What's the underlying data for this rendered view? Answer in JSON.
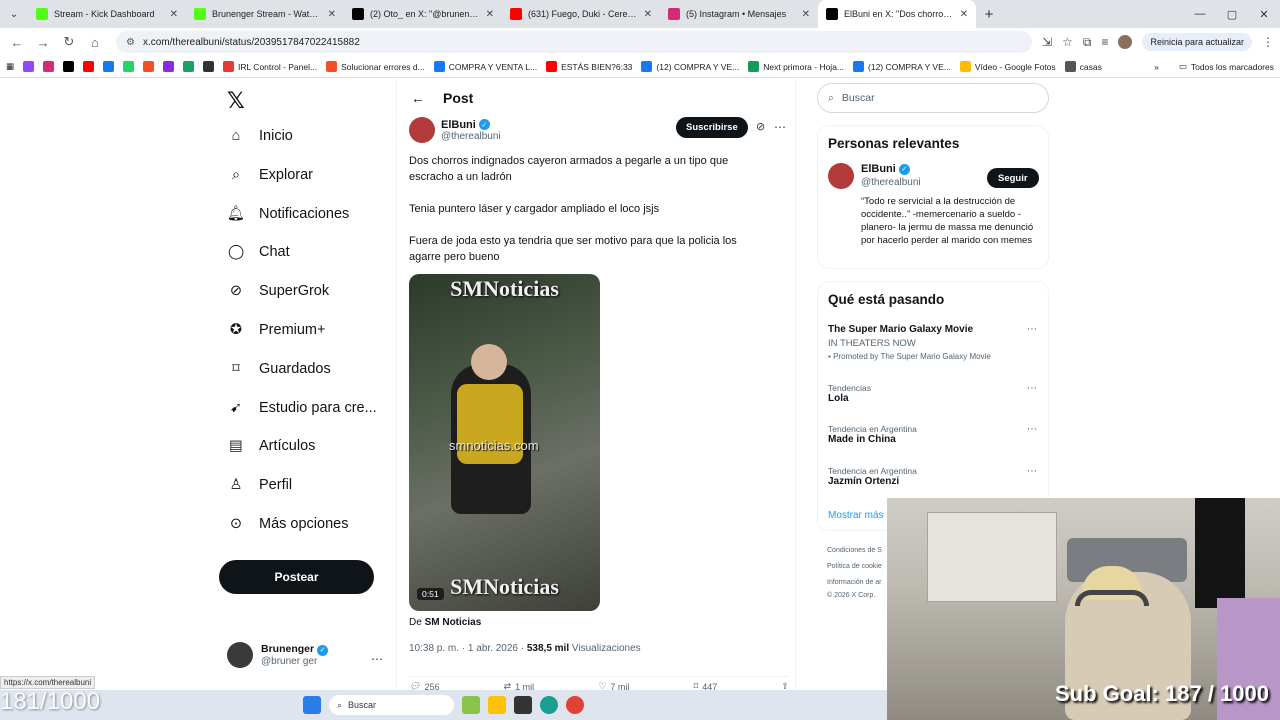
{
  "browser": {
    "tabs": [
      {
        "title": "Stream - Kick Dashboard",
        "icon": "kick-icon",
        "color": "#53fc18",
        "active": false
      },
      {
        "title": "Brunenger Stream - Watch Live",
        "icon": "kick-icon",
        "color": "#53fc18",
        "active": false
      },
      {
        "title": "(2) Oto_ en X: \"@brunenger\"",
        "icon": "x-icon",
        "color": "#000000",
        "active": false
      },
      {
        "title": "(631) Fuego, Duki - Cereza - You",
        "icon": "youtube-icon",
        "color": "#ff0000",
        "active": false
      },
      {
        "title": "(5) Instagram • Mensajes",
        "icon": "instagram-icon",
        "color": "#d62976",
        "active": false
      },
      {
        "title": "ElBuni en X: \"Dos chorros indign",
        "icon": "x-icon",
        "color": "#000000",
        "active": true
      }
    ],
    "url": "x.com/therealbuni/status/2039517847022415882",
    "update_label": "Reinicia para actualizar",
    "bookmarks": [
      {
        "label": "",
        "color": "#9146ff"
      },
      {
        "label": "",
        "color": "#d62976"
      },
      {
        "label": "",
        "color": "#000000"
      },
      {
        "label": "",
        "color": "#ff0000"
      },
      {
        "label": "",
        "color": "#1877f2"
      },
      {
        "label": "",
        "color": "#25d366"
      },
      {
        "label": "",
        "color": "#f25022"
      },
      {
        "label": "",
        "color": "#8a2be2"
      },
      {
        "label": "",
        "color": "#1aa260"
      },
      {
        "label": "",
        "color": "#333333"
      },
      {
        "label": "IRL Control - Panel...",
        "color": "#e53935"
      },
      {
        "label": "Solucionar errores d...",
        "color": "#f25022"
      },
      {
        "label": "COMPRA Y VENTA L...",
        "color": "#1877f2"
      },
      {
        "label": "ESTÁS BIEN?6:33",
        "color": "#ff0000"
      },
      {
        "label": "(12) COMPRA Y VE...",
        "color": "#1877f2"
      },
      {
        "label": "Next primora - Hoja...",
        "color": "#0f9d58"
      },
      {
        "label": "(12) COMPRA Y VE...",
        "color": "#1877f2"
      },
      {
        "label": "Vídeo - Google Fotos",
        "color": "#fbbc04"
      },
      {
        "label": "casas",
        "color": "#555555"
      }
    ],
    "bookmarks_all": "Todos los marcadores"
  },
  "nav": {
    "items": [
      {
        "label": "Inicio",
        "icon": "home-icon"
      },
      {
        "label": "Explorar",
        "icon": "search-icon"
      },
      {
        "label": "Notificaciones",
        "icon": "bell-icon"
      },
      {
        "label": "Chat",
        "icon": "chat-icon"
      },
      {
        "label": "SuperGrok",
        "icon": "grok-icon"
      },
      {
        "label": "Premium+",
        "icon": "verified-icon"
      },
      {
        "label": "Guardados",
        "icon": "bookmark-icon"
      },
      {
        "label": "Estudio para cre...",
        "icon": "rocket-icon"
      },
      {
        "label": "Artículos",
        "icon": "article-icon"
      },
      {
        "label": "Perfil",
        "icon": "person-icon"
      },
      {
        "label": "Más opciones",
        "icon": "more-circle-icon"
      }
    ],
    "post_label": "Postear",
    "account": {
      "name": "Brunenger",
      "handle": "@bruner ger"
    }
  },
  "post": {
    "header": "Post",
    "author": {
      "name": "ElBuni",
      "handle": "@therealbuni"
    },
    "subscribe_label": "Suscribirse",
    "paragraphs": [
      "Dos chorros indignados cayeron armados a pegarle a un tipo que escracho a un ladrón",
      "Tenia puntero láser y cargador ampliado el loco jsjs",
      "Fuera de joda esto ya tendria que ser motivo para que la policia los agarre pero bueno"
    ],
    "media": {
      "watermark": "SMNoticias",
      "site": "smnoticias.com",
      "duration": "0:51"
    },
    "from_prefix": "De",
    "from_source": "SM Noticias",
    "time": "10:38 p. m. · 1 abr. 2026 ·",
    "views_count": "538,5 mil",
    "views_label": "Visualizaciones",
    "stats": {
      "replies": "256",
      "reposts": "1 mil",
      "likes": "7 mil",
      "bookmarks": "447"
    }
  },
  "sidebar": {
    "search_placeholder": "Buscar",
    "relevant_title": "Personas relevantes",
    "relevant": {
      "name": "ElBuni",
      "handle": "@therealbuni",
      "follow_label": "Seguir",
      "bio": "“Todo re servicial a la destrucción de occidente..” -memercenario a sueldo - planero- la jermu de massa me denunció por hacerlo perder al marido con memes"
    },
    "trending_title": "Qué está pasando",
    "trends": [
      {
        "category": "",
        "title": "The Super Mario Galaxy Movie",
        "sub": "IN THEATERS NOW",
        "promo": "Promoted by The Super Mario Galaxy Movie"
      },
      {
        "category": "Tendencias",
        "title": "Lola"
      },
      {
        "category": "Tendencia en Argentina",
        "title": "Made in China"
      },
      {
        "category": "Tendencia en Argentina",
        "title": "Jazmín Ortenzi"
      }
    ],
    "show_more": "Mostrar más",
    "footer": [
      "Condiciones de S",
      "Política de cookie",
      "Información de ar",
      "© 2026 X Corp."
    ]
  },
  "overlay": {
    "sub_goal": "Sub Goal:  187 / 1000",
    "left_counter": "181/1000",
    "status_url": "https://x.com/therealbuni"
  },
  "taskbar": {
    "search_label": "Buscar"
  }
}
